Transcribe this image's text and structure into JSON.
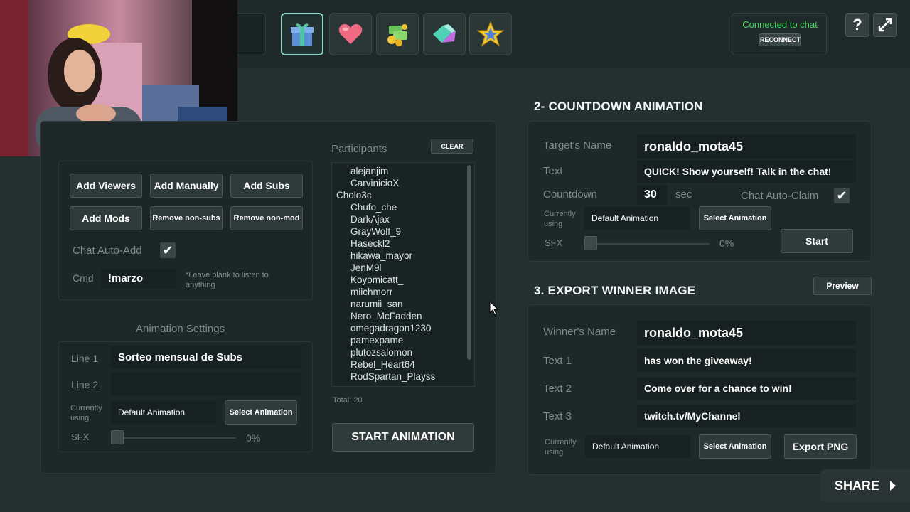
{
  "header": {
    "icon_tiles": [
      "gift-icon",
      "heart-icon",
      "money-icon",
      "gem-icon",
      "star-icon"
    ],
    "connection_status": "Connected to chat",
    "reconnect_label": "RECONNECT",
    "help_label": "?",
    "colors": {
      "status": "#3ce05c",
      "active_tile_border": "#8fd2c8"
    }
  },
  "participants": {
    "title": "Participants",
    "clear_label": "CLEAR",
    "items": [
      "alejanjim",
      "CarvinicioX",
      "Cholo3c",
      "Chufo_che",
      "DarkAjax",
      "GrayWolf_9",
      "Haseckl2",
      "hikawa_mayor",
      "JenM9l",
      "Koyomicatt_",
      "miichmorr",
      "narumii_san",
      "Nero_McFadden",
      "omegadragon1230",
      "pamexpame",
      "plutozsalomon",
      "Rebel_Heart64",
      "RodSpartan_Playss"
    ],
    "total": "Total: 20",
    "start_label": "START ANIMATION"
  },
  "add_controls": {
    "add_viewers": "Add Viewers",
    "add_manually": "Add Manually",
    "add_subs": "Add Subs",
    "add_mods": "Add Mods",
    "remove_nonsubs": "Remove non-subs",
    "remove_nonmod": "Remove non-mod",
    "chat_auto_add": "Chat Auto-Add",
    "cmd_label": "Cmd",
    "cmd_value": "!marzo",
    "cmd_hint": "*Leave blank to listen to anything"
  },
  "animation_settings": {
    "title": "Animation Settings",
    "line1_label": "Line 1",
    "line1_value": "Sorteo mensual de Subs",
    "line2_label": "Line 2",
    "line2_value": "",
    "currently_using_label": "Currently using",
    "current_animation": "Default Animation",
    "select_animation": "Select Animation",
    "sfx_label": "SFX",
    "sfx_value": "0%"
  },
  "countdown": {
    "title": "2- COUNTDOWN ANIMATION",
    "target_label": "Target's Name",
    "target_value": "ronaldo_mota45",
    "text_label": "Text",
    "text_value": "QUICK! Show yourself! Talk in the chat!",
    "countdown_label": "Countdown",
    "countdown_value": "30",
    "countdown_unit": "sec",
    "chat_auto_claim": "Chat Auto-Claim",
    "currently_using_label": "Currently using",
    "current_animation": "Default Animation",
    "select_animation": "Select Animation",
    "sfx_label": "SFX",
    "sfx_value": "0%",
    "start_label": "Start"
  },
  "export": {
    "title": "3. EXPORT WINNER IMAGE",
    "preview_label": "Preview",
    "winner_label": "Winner's Name",
    "winner_value": "ronaldo_mota45",
    "text1_label": "Text 1",
    "text1_value": "has won the giveaway!",
    "text2_label": "Text 2",
    "text2_value": "Come over for a chance to win!",
    "text3_label": "Text 3",
    "text3_value": "twitch.tv/MyChannel",
    "currently_using_label": "Currently using",
    "current_animation": "Default Animation",
    "select_animation": "Select Animation",
    "export_label": "Export PNG"
  },
  "share_label": "SHARE"
}
